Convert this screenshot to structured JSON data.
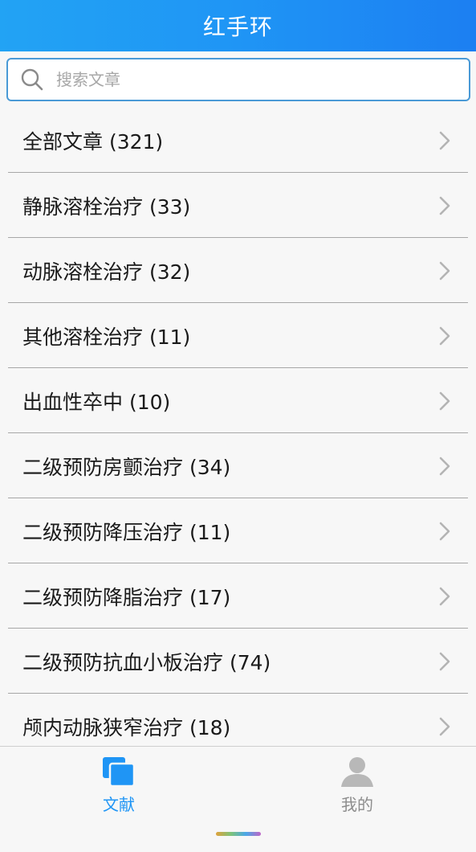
{
  "header": {
    "title": "红手环"
  },
  "search": {
    "placeholder": "搜索文章",
    "icon": "search-icon"
  },
  "list": {
    "items": [
      {
        "label": "全部文章 (321)"
      },
      {
        "label": "静脉溶栓治疗 (33)"
      },
      {
        "label": "动脉溶栓治疗 (32)"
      },
      {
        "label": "其他溶栓治疗 (11)"
      },
      {
        "label": "出血性卒中 (10)"
      },
      {
        "label": "二级预防房颤治疗 (34)"
      },
      {
        "label": "二级预防降压治疗 (11)"
      },
      {
        "label": "二级预防降脂治疗 (17)"
      },
      {
        "label": "二级预防抗血小板治疗 (74)"
      },
      {
        "label": "颅内动脉狭窄治疗 (18)"
      }
    ]
  },
  "tabbar": {
    "tabs": [
      {
        "label": "文献",
        "icon": "documents-icon",
        "active": true
      },
      {
        "label": "我的",
        "icon": "user-icon",
        "active": false
      }
    ]
  },
  "colors": {
    "header_start": "#22a3f4",
    "header_end": "#1c7ff2",
    "active_tab": "#1f95f5",
    "inactive_tab": "#8d8d8d",
    "background": "#f7f7f7"
  }
}
